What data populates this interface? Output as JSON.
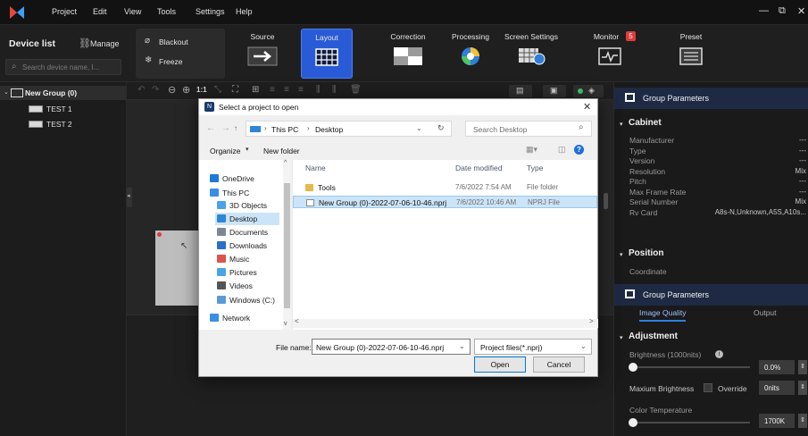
{
  "menu": {
    "items": [
      "Project",
      "Edit",
      "View",
      "Tools",
      "Settings",
      "Help"
    ],
    "window_controls": [
      "—",
      "⧉",
      "✕"
    ]
  },
  "toolbar": {
    "device_list": "Device list",
    "manage": "Manage",
    "search_placeholder": "Search device name, I...",
    "blackout": "Blackout",
    "freeze": "Freeze",
    "buttons": [
      "Source",
      "Layout",
      "Correction",
      "Processing",
      "Screen Settings",
      "Monitor",
      "Preset"
    ],
    "monitor_badge": "5",
    "active": "Layout"
  },
  "tree": {
    "group": "New Group (0)",
    "items": [
      "TEST 1",
      "TEST 2"
    ]
  },
  "canvas_toolbar": {
    "zoom_label": "1:1"
  },
  "right_panel": {
    "group_params_title": "Group Parameters",
    "cabinet_title": "Cabinet",
    "cabinet_rows": [
      {
        "label": "Manufacturer",
        "value": "---"
      },
      {
        "label": "Type",
        "value": "---"
      },
      {
        "label": "Version",
        "value": "---"
      },
      {
        "label": "Resolution",
        "value": "Mix"
      },
      {
        "label": "Pitch",
        "value": "---"
      },
      {
        "label": "Max Frame Rate",
        "value": "---"
      },
      {
        "label": "Serial Number",
        "value": "Mix"
      },
      {
        "label": "Rv Card",
        "value": "A8s-N,Unknown,A5S,A10s..."
      }
    ],
    "position_title": "Position",
    "coordinate_label": "Coordinate",
    "group_params_title2": "Group Parameters",
    "tabs": [
      "Image Quality",
      "Output"
    ],
    "adjustment_title": "Adjustment",
    "brightness_label": "Brightness (1000nits)",
    "brightness_value": "0.0%",
    "brightness_level": 0,
    "max_brightness_label": "Maxium Brightness",
    "override_label": "Override",
    "max_brightness_value": "0nits",
    "color_temp_label": "Color Temperature",
    "color_temp_value": "1700K",
    "color_temp_level": 0
  },
  "dialog": {
    "title": "Select a project to open",
    "path": [
      "This PC",
      "Desktop"
    ],
    "search_placeholder": "Search Desktop",
    "organize": "Organize",
    "new_folder": "New folder",
    "nav_items": [
      {
        "label": "OneDrive",
        "icon": "cloud-icon",
        "color": "#1e7ad6"
      },
      {
        "label": "This PC",
        "icon": "pc-icon",
        "color": "#3a8ee6"
      },
      {
        "label": "3D Objects",
        "icon": "cube-icon",
        "color": "#4aa3e8"
      },
      {
        "label": "Desktop",
        "icon": "desktop-icon",
        "color": "#2d86d9"
      },
      {
        "label": "Documents",
        "icon": "document-icon",
        "color": "#7b8794"
      },
      {
        "label": "Downloads",
        "icon": "download-icon",
        "color": "#2a6fc9"
      },
      {
        "label": "Music",
        "icon": "music-icon",
        "color": "#d9534f"
      },
      {
        "label": "Pictures",
        "icon": "picture-icon",
        "color": "#4aa3e8"
      },
      {
        "label": "Videos",
        "icon": "video-icon",
        "color": "#555"
      },
      {
        "label": "Windows (C:)",
        "icon": "drive-icon",
        "color": "#5b9bd5"
      },
      {
        "label": "Network",
        "icon": "network-icon",
        "color": "#3a8ee6"
      }
    ],
    "columns": [
      "Name",
      "Date modified",
      "Type"
    ],
    "files": [
      {
        "name": "Tools",
        "date": "7/6/2022 7:54 AM",
        "type": "File folder",
        "icon": "folder-icon"
      },
      {
        "name": "New Group (0)-2022-07-06-10-46.nprj",
        "date": "7/6/2022 10:46 AM",
        "type": "NPRJ File",
        "icon": "file-icon"
      }
    ],
    "filename_label": "File name:",
    "filename_value": "New Group (0)-2022-07-06-10-46.nprj",
    "filter_value": "Project files(*.nprj)",
    "open_label": "Open",
    "cancel_label": "Cancel"
  }
}
